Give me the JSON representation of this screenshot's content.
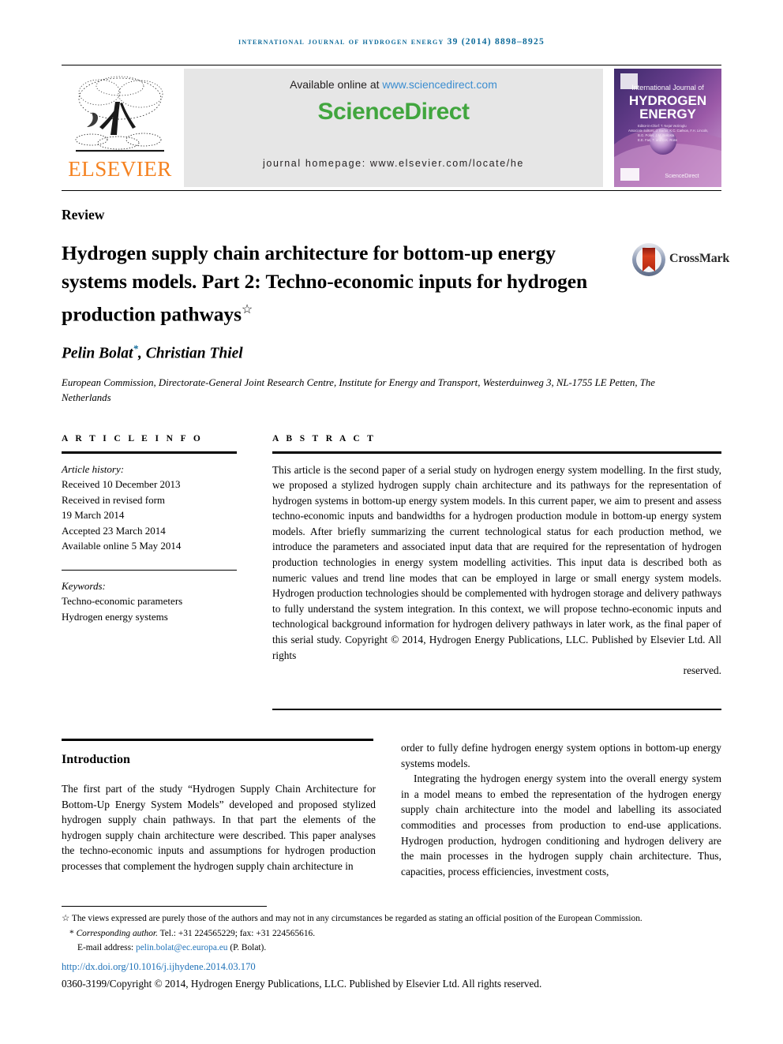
{
  "running_head": "International Journal of Hydrogen Energy 39 (2014) 8898–8925",
  "masthead": {
    "publisher_name": "ELSEVIER",
    "available_prefix": "Available online at ",
    "available_url": "www.sciencedirect.com",
    "sciencedirect_logo": "ScienceDirect",
    "journal_homepage": "journal homepage: www.elsevier.com/locate/he",
    "cover": {
      "line1": "International Journal of",
      "line2": "HYDROGEN",
      "line3": "ENERGY",
      "editors_line1": "Editor-in-Chief: T. Nejat Veziroglu",
      "editors_line2": "Associate Editors: J. Barbir, K.C. Carlson, F.H. Lincoln,",
      "editors_line3": "B.G. Pollet, J.M. Bellosta",
      "editors_line4": "E.E. Fan, T. and D.K. Ross",
      "footer_brand": "ScienceDirect"
    }
  },
  "article": {
    "type": "Review",
    "title": "Hydrogen supply chain architecture for bottom-up energy systems models. Part 2: Techno-economic inputs for hydrogen production pathways",
    "title_footnote_marker": "☆",
    "crossmark_label": "CrossMark",
    "authors": "Pelin Bolat",
    "author_marker": "*",
    "authors_rest": ", Christian Thiel",
    "affiliation": "European Commission, Directorate-General Joint Research Centre, Institute for Energy and Transport, Westerduinweg 3, NL-1755 LE Petten, The Netherlands"
  },
  "info": {
    "label": "A R T I C L E   I N F O",
    "history_label": "Article history:",
    "history": [
      "Received 10 December 2013",
      "Received in revised form",
      "19 March 2014",
      "Accepted 23 March 2014",
      "Available online 5 May 2014"
    ],
    "keywords_label": "Keywords:",
    "keywords": [
      "Techno-economic parameters",
      "Hydrogen energy systems"
    ]
  },
  "abstract": {
    "label": "A B S T R A C T",
    "text": "This article is the second paper of a serial study on hydrogen energy system modelling. In the first study, we proposed a stylized hydrogen supply chain architecture and its pathways for the representation of hydrogen systems in bottom-up energy system models. In this current paper, we aim to present and assess techno-economic inputs and bandwidths for a hydrogen production module in bottom-up energy system models. After briefly summarizing the current technological status for each production method, we introduce the parameters and associated input data that are required for the representation of hydrogen production technologies in energy system modelling activities. This input data is described both as numeric values and trend line modes that can be employed in large or small energy system models. Hydrogen production technologies should be complemented with hydrogen storage and delivery pathways to fully understand the system integration. In this context, we will propose techno-economic inputs and technological background information for hydrogen delivery pathways in later work, as the final paper of this serial study.",
    "copyright": "Copyright © 2014, Hydrogen Energy Publications, LLC. Published by Elsevier Ltd. All rights",
    "copyright_last": "reserved."
  },
  "body": {
    "intro_heading": "Introduction",
    "left_paragraph": "The first part of the study “Hydrogen Supply Chain Architecture for Bottom-Up Energy System Models” developed and proposed stylized hydrogen supply chain pathways. In that part the elements of the hydrogen supply chain architecture were described. This paper analyses the techno-economic inputs and assumptions for hydrogen production processes that complement the hydrogen supply chain architecture in",
    "right_paragraph_1": "order to fully define hydrogen energy system options in bottom-up energy systems models.",
    "right_paragraph_2": "Integrating the hydrogen energy system into the overall energy system in a model means to embed the representation of the hydrogen energy supply chain architecture into the model and labelling its associated commodities and processes from production to end-use applications. Hydrogen production, hydrogen conditioning and hydrogen delivery are the main processes in the hydrogen supply chain architecture. Thus, capacities, process efficiencies, investment costs,"
  },
  "footnotes": {
    "star_marker": "☆",
    "star_text": "The views expressed are purely those of the authors and may not in any circumstances be regarded as stating an official position of the European Commission.",
    "corresponding_marker": "*",
    "corresponding_text": "Corresponding author.",
    "corresponding_contact": " Tel.: +31 224565229; fax: +31 224565616.",
    "email_label": "E-mail address: ",
    "email": "pelin.bolat@ec.europa.eu",
    "email_suffix": " (P. Bolat).",
    "doi": "http://dx.doi.org/10.1016/j.ijhydene.2014.03.170",
    "issn_line": "0360-3199/Copyright © 2014, Hydrogen Energy Publications, LLC. Published by Elsevier Ltd. All rights reserved."
  },
  "colors": {
    "journal_blue": "#0d6a9a",
    "elsevier_orange": "#F58220",
    "sciencedirect_green": "#41a63e",
    "link_blue": "#1f72b8",
    "banner_gray": "#e6e6e6"
  }
}
